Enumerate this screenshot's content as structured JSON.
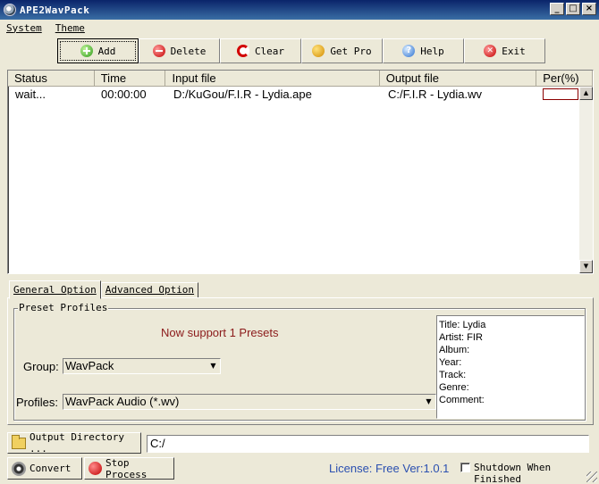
{
  "window": {
    "title": "APE2WavPack",
    "minimize": "_",
    "maximize": "□",
    "close": "×"
  },
  "menu": {
    "items": [
      {
        "label": "System"
      },
      {
        "label": "Theme"
      }
    ]
  },
  "toolbar": {
    "add": "Add",
    "delete": "Delete",
    "clear": "Clear",
    "get_pro": "Get Pro",
    "help": "Help",
    "exit": "Exit",
    "help_glyph": "?",
    "exit_glyph": "✕"
  },
  "file_list": {
    "columns": [
      "Status",
      "Time",
      "Input file",
      "Output file",
      "Per(%)"
    ],
    "rows": [
      {
        "status": "wait...",
        "time": "00:00:00",
        "input": "D:/KuGou/F.I.R - Lydia.ape",
        "output": "C:/F.I.R - Lydia.wv",
        "percent": 0
      }
    ],
    "scroll_up": "▲",
    "scroll_down": "▼"
  },
  "tabs": [
    {
      "label": "General Option",
      "active": true
    },
    {
      "label": "Advanced Option",
      "active": false
    }
  ],
  "presets": {
    "legend": "Preset Profiles",
    "support_text": "Now support 1 Presets",
    "group_label": "Group:",
    "group_value": "WavPack",
    "profiles_label": "Profiles:",
    "profiles_value": "WavPack Audio (*.wv)",
    "dropdown_glyph": "▼"
  },
  "metadata": {
    "title": "Title:  Lydia",
    "artist": "Artist:  FIR",
    "album": "Album:",
    "year": "Year:",
    "track": "Track:",
    "genre": "Genre:",
    "comment": "Comment:"
  },
  "output": {
    "button": "Output Directory ...",
    "path": "C:/"
  },
  "actions": {
    "convert": "Convert",
    "stop": "Stop Process"
  },
  "footer": {
    "license": "License: Free Ver:1.0.1",
    "shutdown_label": "Shutdown When Finished",
    "shutdown_checked": false
  },
  "colors": {
    "titlebar": "#0a246a",
    "support_text": "#8b1a1a",
    "license_text": "#2a4fb0"
  }
}
